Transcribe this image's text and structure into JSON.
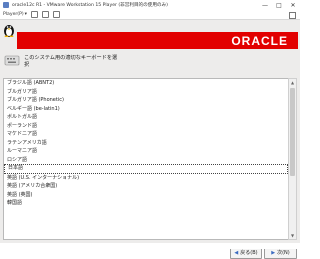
{
  "window": {
    "title": "oracle12c R1 - VMware Workstation 15 Player (非営利目的の使用のみ)",
    "player_menu": "Player(P)",
    "controls": [
      "—",
      "□",
      "✕"
    ]
  },
  "banner": {
    "logo": "ORACLE"
  },
  "installer": {
    "prompt": "このシステム用の適切なキーボードを選\n択",
    "keyboards": [
      "ブラジル語 (ABNT2)",
      "ブルガリア語",
      "ブルガリア語 (Phonetic)",
      "ベルギー語 (be-latin1)",
      "ボルトガル語",
      "ポーランド語",
      "マケドニア語",
      "ラテンアメリカ語",
      "ルーマニア語",
      "ロシア語",
      "日本語",
      "英語 (U.S. インターナショナル)",
      "英語 (アメリカ合衆国)",
      "英語 (英国)",
      "韓国語"
    ],
    "selected": "日本語",
    "back_label": "戻る(B)",
    "next_label": "次(N)"
  },
  "colors": {
    "banner_red": "#e20000",
    "vm_background": "#edeceb"
  },
  "icons": {
    "app": "vmware-icon",
    "tux": "tux-penguin-icon",
    "prompt": "keyboard-icon",
    "back": "arrow-left-icon",
    "next": "arrow-right-icon"
  }
}
